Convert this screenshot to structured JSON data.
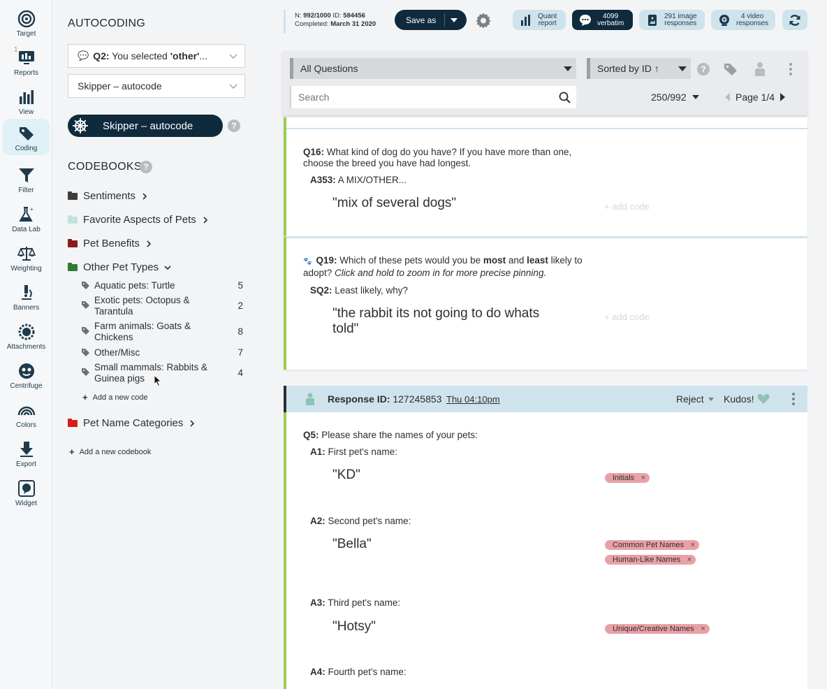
{
  "rail": [
    {
      "label": "Target",
      "icon": "target-icon"
    },
    {
      "label": "Reports",
      "icon": "reports-icon",
      "badge": "1"
    },
    {
      "label": "View",
      "icon": "bar-chart-icon"
    },
    {
      "label": "Coding",
      "icon": "tag-icon",
      "active": true
    },
    {
      "label": "Filter",
      "icon": "filter-icon"
    },
    {
      "label": "Data Lab",
      "icon": "flask-icon"
    },
    {
      "label": "Weighting",
      "icon": "scale-icon"
    },
    {
      "label": "Banners",
      "icon": "microscope-icon"
    },
    {
      "label": "Attachments",
      "icon": "attachments-icon"
    },
    {
      "label": "Centrifuge",
      "icon": "centrifuge-icon"
    },
    {
      "label": "Colors",
      "icon": "rainbow-icon"
    },
    {
      "label": "Export",
      "icon": "download-icon"
    },
    {
      "label": "Widget",
      "icon": "widget-icon"
    }
  ],
  "panel": {
    "title": "AUTOCODING",
    "question_select": {
      "prefix": "Q2:",
      "text": " You selected ",
      "bold": "'other'",
      "suffix": "..."
    },
    "autocoder_select": "Skipper – autocode",
    "autocode_button": "Skipper – autocode",
    "codebooks_title": "CODEBOOKS",
    "codebooks": [
      {
        "name": "Sentiments",
        "color": "#3d3d3d"
      },
      {
        "name": "Favorite Aspects of Pets",
        "color": "#bfe3df"
      },
      {
        "name": "Pet Benefits",
        "color": "#8b1a1a"
      },
      {
        "name": "Other Pet Types",
        "color": "#2e7d32",
        "expanded": true
      },
      {
        "name": "Pet Name Categories",
        "color": "#d81b1b"
      }
    ],
    "codes": [
      {
        "label": "Aquatic pets: Turtle",
        "count": "5"
      },
      {
        "label": "Exotic pets: Octopus & Tarantula",
        "count": "2"
      },
      {
        "label": "Farm animals: Goats & Chickens",
        "count": "8"
      },
      {
        "label": "Other/Misc",
        "count": "7"
      },
      {
        "label": "Small mammals: Rabbits & Guinea pigs",
        "count": "4"
      }
    ],
    "add_code": "Add a new code",
    "add_codebook": "Add a new codebook"
  },
  "topbar": {
    "n_label": "N:",
    "n_value": "992/1000",
    "id_label": "ID:",
    "id_value": "584456",
    "completed_label": "Completed:",
    "completed_value": "March 31 2020",
    "save_as": "Save as",
    "pills": [
      {
        "line1": "Quant",
        "line2": "report",
        "icon": "bar-chart-icon"
      },
      {
        "line1": "4099",
        "line2": "verbatim",
        "icon": "speech-bubble-icon",
        "dark": true
      },
      {
        "line1": "291 image",
        "line2": "responses",
        "icon": "image-icon"
      },
      {
        "line1": "4 video",
        "line2": "responses",
        "icon": "video-icon"
      }
    ]
  },
  "filterbar": {
    "question_filter": "All Questions",
    "sort": "Sorted by ID ↑",
    "search_placeholder": "Search",
    "count": "250/992",
    "page": "Page 1/4"
  },
  "cards": {
    "q16": {
      "qnum": "Q16:",
      "qtext": " What kind of dog do you have? If you have more than one, choose the breed you have had longest.",
      "sub": "A353:",
      "sub_text": " A MIX/OTHER...",
      "answer": "\"mix of several dogs\"",
      "add_code": "+ add code"
    },
    "q19": {
      "qnum": "Q19:",
      "q_a": " Which of these pets would you be ",
      "q_most": "most",
      "q_b": " and ",
      "q_least": "least",
      "q_c": " likely to adopt? ",
      "q_italic": "Click and hold to zoom in for more precise pinning.",
      "sub": "SQ2:",
      "sub_text": " Least likely, why?",
      "answer": "\"the rabbit its not going to do whats told\"",
      "add_code": "+ add code"
    }
  },
  "response": {
    "id_label": "Response ID:",
    "id_value": "127245853",
    "time": "Thu 04:10pm",
    "reject": "Reject",
    "kudos": "Kudos!",
    "question": {
      "qnum": "Q5:",
      "qtext": " Please share the names of your pets:"
    },
    "answers": [
      {
        "sub": "A1:",
        "text": " First pet's name:",
        "answer": "\"KD\"",
        "tags": [
          "Initials"
        ]
      },
      {
        "sub": "A2:",
        "text": " Second pet's name:",
        "answer": "\"Bella\"",
        "tags": [
          "Common Pet Names",
          "Human-Like Names"
        ]
      },
      {
        "sub": "A3:",
        "text": " Third pet's name:",
        "answer": "\"Hotsy\"",
        "tags": [
          "Unique/Creative Names"
        ]
      },
      {
        "sub": "A4:",
        "text": " Fourth pet's name:"
      }
    ]
  }
}
